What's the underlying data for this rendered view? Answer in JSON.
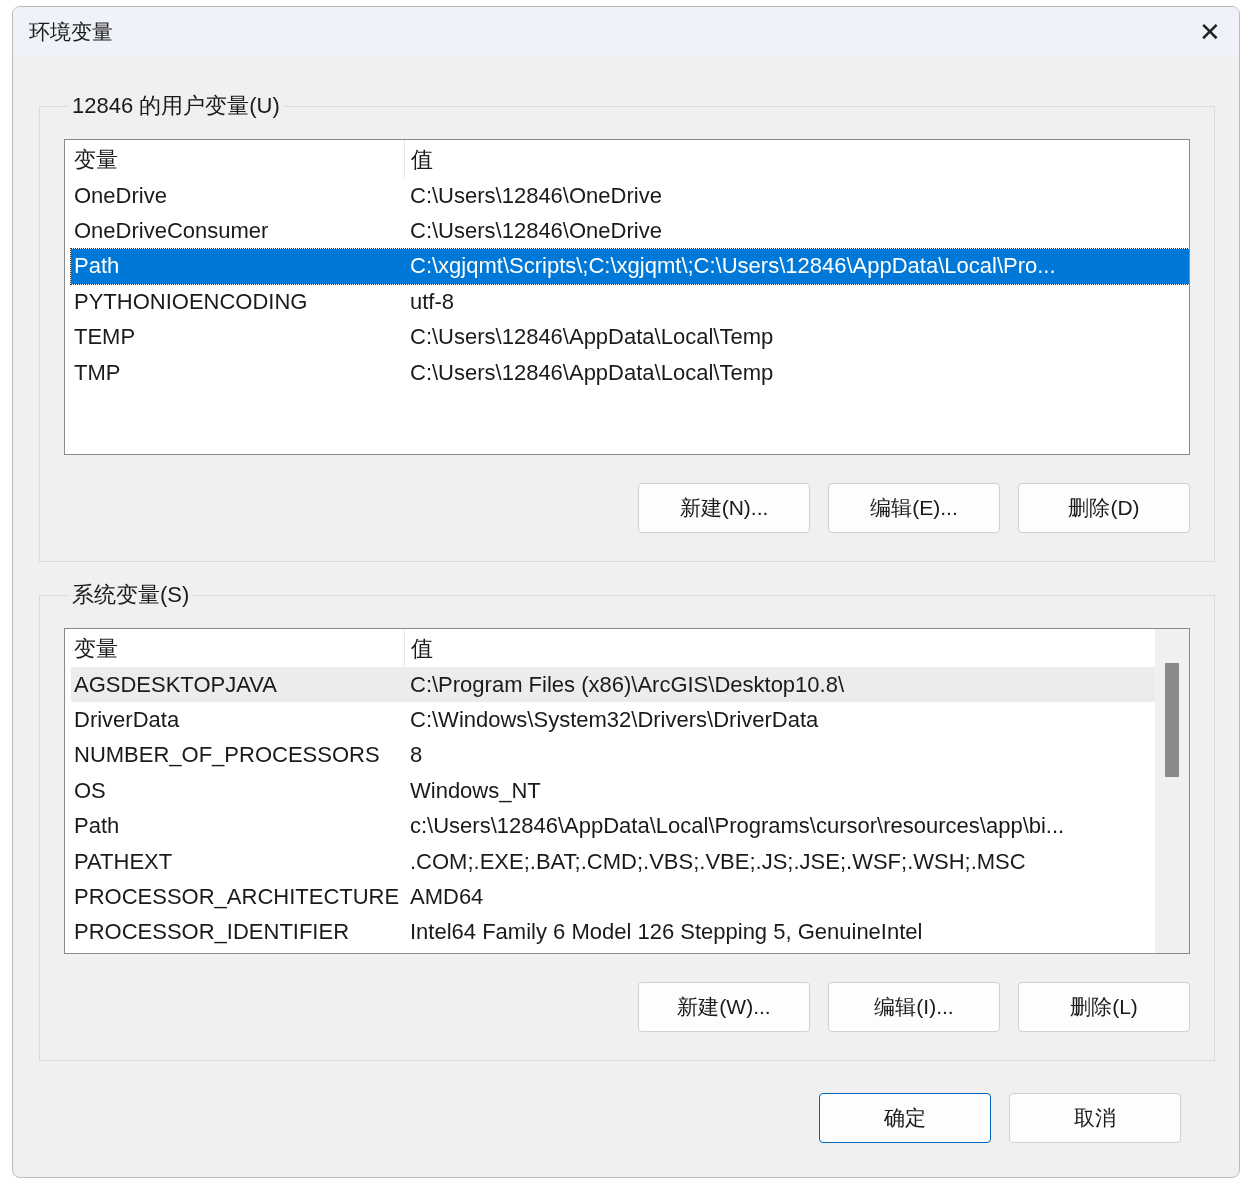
{
  "window": {
    "title": "环境变量",
    "close": "✕"
  },
  "groups": [
    {
      "title": "12846 的用户变量(U)",
      "focused": true,
      "scrollbar": false,
      "columns": [
        "变量",
        "值"
      ],
      "rows": [
        {
          "name": "OneDrive",
          "value": "C:\\Users\\12846\\OneDrive",
          "selected": false
        },
        {
          "name": "OneDriveConsumer",
          "value": "C:\\Users\\12846\\OneDrive",
          "selected": false
        },
        {
          "name": "Path",
          "value": "C:\\xgjqmt\\Scripts\\;C:\\xgjqmt\\;C:\\Users\\12846\\AppData\\Local\\Pro...",
          "selected": true
        },
        {
          "name": "PYTHONIOENCODING",
          "value": "utf-8",
          "selected": false
        },
        {
          "name": "TEMP",
          "value": "C:\\Users\\12846\\AppData\\Local\\Temp",
          "selected": false
        },
        {
          "name": "TMP",
          "value": "C:\\Users\\12846\\AppData\\Local\\Temp",
          "selected": false
        }
      ],
      "buttons": [
        "新建(N)...",
        "编辑(E)...",
        "删除(D)"
      ]
    },
    {
      "title": "系统变量(S)",
      "focused": false,
      "scrollbar": true,
      "columns": [
        "变量",
        "值"
      ],
      "rows": [
        {
          "name": "AGSDESKTOPJAVA",
          "value": "C:\\Program Files (x86)\\ArcGIS\\Desktop10.8\\",
          "selected": true
        },
        {
          "name": "DriverData",
          "value": "C:\\Windows\\System32\\Drivers\\DriverData",
          "selected": false
        },
        {
          "name": "NUMBER_OF_PROCESSORS",
          "value": "8",
          "selected": false
        },
        {
          "name": "OS",
          "value": "Windows_NT",
          "selected": false
        },
        {
          "name": "Path",
          "value": "c:\\Users\\12846\\AppData\\Local\\Programs\\cursor\\resources\\app\\bi...",
          "selected": false
        },
        {
          "name": "PATHEXT",
          "value": ".COM;.EXE;.BAT;.CMD;.VBS;.VBE;.JS;.JSE;.WSF;.WSH;.MSC",
          "selected": false
        },
        {
          "name": "PROCESSOR_ARCHITECTURE",
          "value": "AMD64",
          "selected": false
        },
        {
          "name": "PROCESSOR_IDENTIFIER",
          "value": "Intel64 Family 6 Model 126 Stepping 5, GenuineIntel",
          "selected": false
        }
      ],
      "buttons": [
        "新建(W)...",
        "编辑(I)...",
        "删除(L)"
      ]
    }
  ],
  "footer_buttons": [
    {
      "label": "确定",
      "default": true
    },
    {
      "label": "取消",
      "default": false
    }
  ]
}
